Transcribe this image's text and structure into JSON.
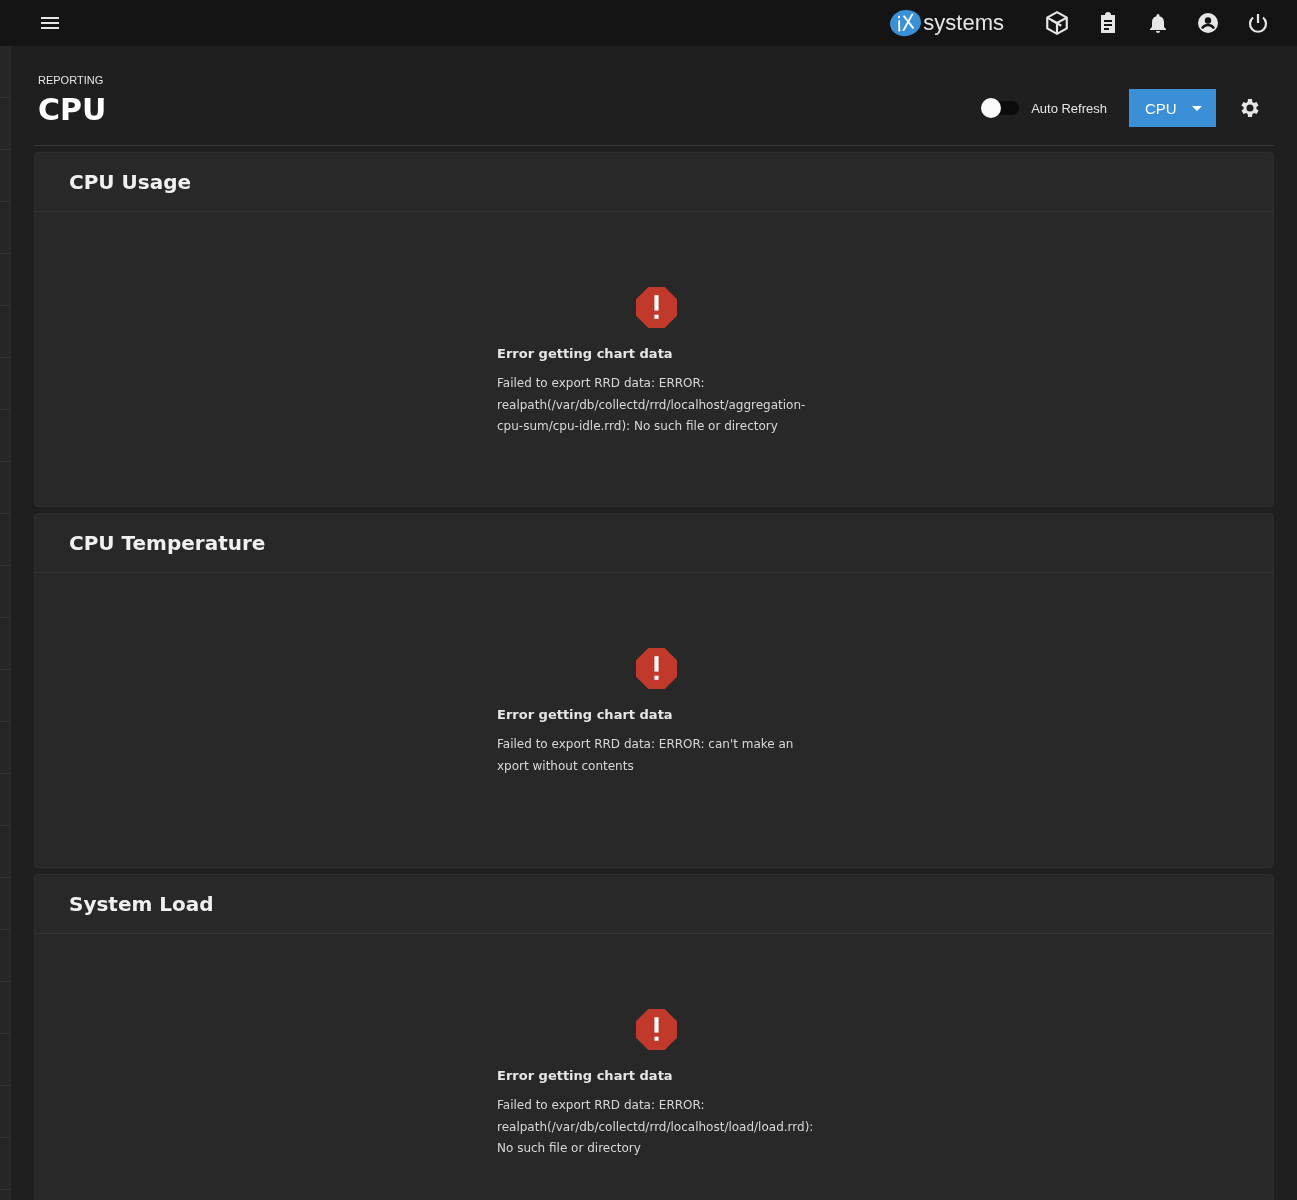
{
  "top_bar": {
    "logo": {
      "badge": "iX",
      "word": "systems"
    }
  },
  "header": {
    "breadcrumb": "REPORTING",
    "title": "CPU",
    "auto_refresh": {
      "label": "Auto Refresh",
      "on": false
    },
    "report_select": {
      "value": "CPU"
    }
  },
  "cards": [
    {
      "title": "CPU Usage",
      "error": {
        "heading": "Error getting chart data",
        "message": "Failed to export RRD data: ERROR: realpath(/var/db/collectd/rrd/localhost/aggregation-cpu-sum/cpu-idle.rrd): No such file or directory"
      }
    },
    {
      "title": "CPU Temperature",
      "error": {
        "heading": "Error getting chart data",
        "message": "Failed to export RRD data: ERROR: can't make an xport without contents"
      }
    },
    {
      "title": "System Load",
      "error": {
        "heading": "Error getting chart data",
        "message": "Failed to export RRD data: ERROR: realpath(/var/db/collectd/rrd/localhost/load/load.rrd): No such file or directory"
      }
    }
  ]
}
